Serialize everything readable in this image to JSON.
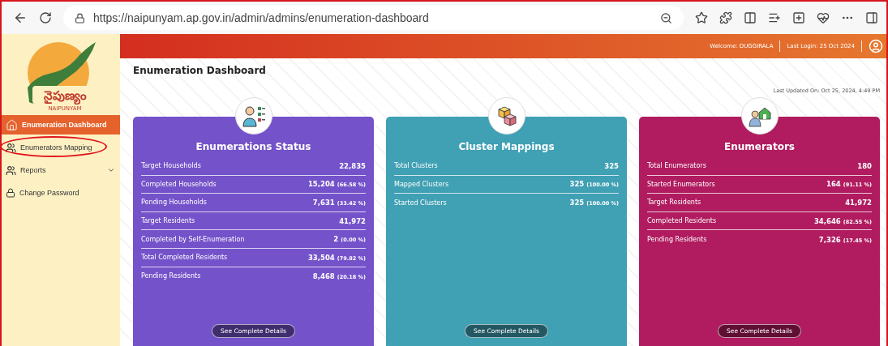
{
  "browser": {
    "url": "https://naipunyam.ap.gov.in/admin/admins/enumeration-dashboard"
  },
  "header": {
    "welcome": "Welcome: DUGGIRALA",
    "last_login": "Last Login: 25 Oct 2024"
  },
  "logo": {
    "title": "నైపుణ్యం",
    "subtitle": "NAIPUNYAM"
  },
  "sidebar": {
    "items": [
      {
        "label": "Enumeration Dashboard",
        "kind": "home",
        "selected": true,
        "circled": false,
        "has_submenu": false
      },
      {
        "label": "Enumerators Mapping",
        "kind": "people",
        "selected": false,
        "circled": true,
        "has_submenu": false
      },
      {
        "label": "Reports",
        "kind": "people",
        "selected": false,
        "circled": false,
        "has_submenu": true
      },
      {
        "label": "Change Password",
        "kind": "lock",
        "selected": false,
        "circled": false,
        "has_submenu": false
      }
    ]
  },
  "page": {
    "title": "Enumeration Dashboard",
    "last_updated": "Last Updated On: Oct 25, 2024, 4:49 PM"
  },
  "cards": [
    {
      "title": "Enumerations Status",
      "color": "#7452c9",
      "kind": "checklist",
      "button": "See Complete Details",
      "rows": [
        {
          "label": "Target Households",
          "value": "22,835"
        },
        {
          "label": "Completed Households",
          "value": "15,204",
          "percent": "(66.58 %)"
        },
        {
          "label": "Pending Households",
          "value": "7,631",
          "percent": "(33.42 %)"
        },
        {
          "label": "Target Residents",
          "value": "41,972"
        },
        {
          "label": "Completed by Self-Enumeration",
          "value": "2",
          "percent": "(0.00 %)"
        },
        {
          "label": "Total Completed Residents",
          "value": "33,504",
          "percent": "(79.82 %)"
        },
        {
          "label": "Pending Residents",
          "value": "8,468",
          "percent": "(20.18 %)"
        }
      ]
    },
    {
      "title": "Cluster Mappings",
      "color": "#40a0b4",
      "kind": "cubes",
      "button": "See Complete Details",
      "rows": [
        {
          "label": "Total Clusters",
          "value": "325"
        },
        {
          "label": "Mapped Clusters",
          "value": "325",
          "percent": "(100.00 %)"
        },
        {
          "label": "Started Clusters",
          "value": "325",
          "percent": "(100.00 %)"
        }
      ]
    },
    {
      "title": "Enumerators",
      "color": "#b01c5f",
      "kind": "house",
      "button": "See Complete Details",
      "rows": [
        {
          "label": "Total Enumerators",
          "value": "180"
        },
        {
          "label": "Started Enumerators",
          "value": "164",
          "percent": "(91.11 %)"
        },
        {
          "label": "Target Residents",
          "value": "41,972"
        },
        {
          "label": "Completed Residents",
          "value": "34,646",
          "percent": "(82.55 %)"
        },
        {
          "label": "Pending Residents",
          "value": "7,326",
          "percent": "(17.45 %)"
        }
      ]
    }
  ]
}
